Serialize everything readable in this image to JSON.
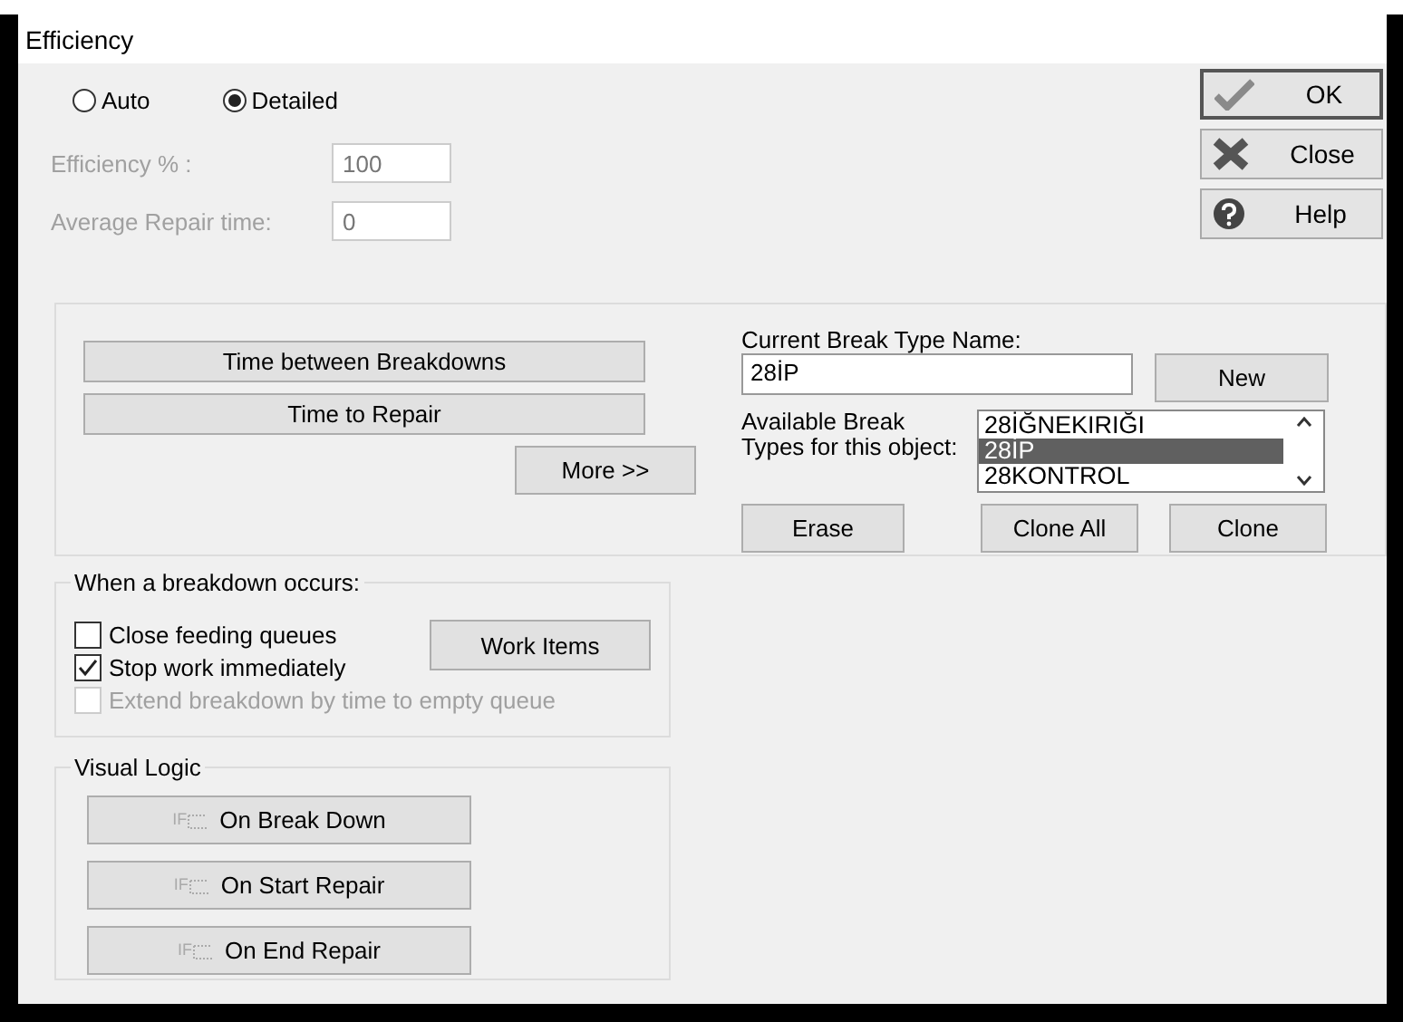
{
  "window": {
    "title": "Efficiency"
  },
  "mode": [
    {
      "label": "Auto",
      "selected": false
    },
    {
      "label": "Detailed",
      "selected": true
    }
  ],
  "fields": [
    {
      "label": "Efficiency % :",
      "value": "100",
      "disabled": true
    },
    {
      "label": "Average Repair time:",
      "value": "0",
      "disabled": true
    }
  ],
  "dialog_buttons": [
    {
      "kind": "ok",
      "label": "OK"
    },
    {
      "kind": "close",
      "label": "Close"
    },
    {
      "kind": "help",
      "label": "Help"
    }
  ],
  "break_settings": {
    "buttons": [
      "Time between Breakdowns",
      "Time to Repair"
    ],
    "more_button": "More >>",
    "name_label": "Current Break Type Name:",
    "name_value": "28İP",
    "new_button": "New",
    "list_label": "Available Break Types for this object:",
    "list_items": [
      {
        "label": "28İĞNEKIRIĞI",
        "selected": false
      },
      {
        "label": "28İP",
        "selected": true
      },
      {
        "label": "28KONTROL",
        "selected": false
      }
    ],
    "actions": [
      "Erase",
      "Clone All",
      "Clone"
    ]
  },
  "breakdown_group": {
    "title": "When a breakdown occurs:",
    "options": [
      {
        "label": "Close feeding queues",
        "checked": false,
        "disabled": false
      },
      {
        "label": "Stop work immediately",
        "checked": true,
        "disabled": false
      },
      {
        "label": "Extend breakdown by time to empty queue",
        "checked": false,
        "disabled": true
      }
    ],
    "work_items_button": "Work Items"
  },
  "visual_logic": {
    "title": "Visual Logic",
    "buttons": [
      {
        "icon_text": "IF",
        "label": "On Break Down"
      },
      {
        "icon_text": "IF",
        "label": "On Start Repair"
      },
      {
        "icon_text": "IF",
        "label": "On End Repair"
      }
    ]
  }
}
